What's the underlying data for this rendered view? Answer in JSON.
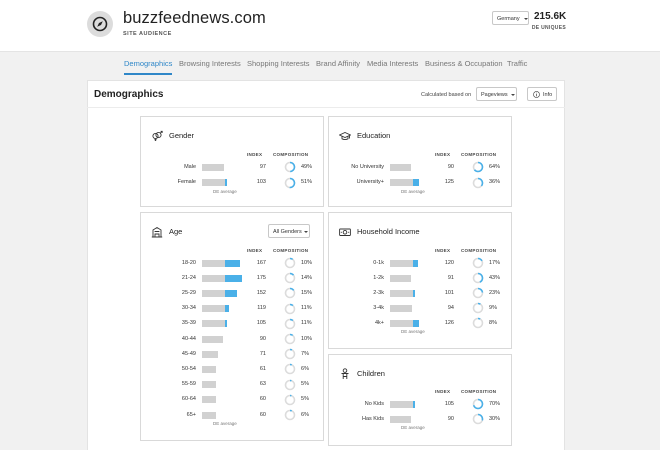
{
  "site": {
    "name": "buzzfeednews.com",
    "subtitle": "SITE AUDIENCE"
  },
  "country": "Germany",
  "uniques": {
    "value": "215.6K",
    "label": "DE UNIQUES"
  },
  "tabs": [
    "Demographics",
    "Browsing Interests",
    "Shopping Interests",
    "Brand Affinity",
    "Media Interests",
    "Business & Occupation",
    "Traffic"
  ],
  "main": {
    "title": "Demographics",
    "calc_label": "Calculated based on",
    "calc_value": "Pageviews",
    "info_label": "Info"
  },
  "headers": {
    "index": "INDEX",
    "composition": "COMPOSITION",
    "avg": "DE average"
  },
  "accent_color": "#4ab0e8",
  "bar_track_color": "#d1d1d1",
  "cards": {
    "gender": {
      "title": "Gender",
      "icon": "gender-icon",
      "rows": [
        {
          "label": "Male",
          "index": 97,
          "comp": 49
        },
        {
          "label": "Female",
          "index": 103,
          "comp": 51
        }
      ]
    },
    "education": {
      "title": "Education",
      "icon": "graduation-cap-icon",
      "rows": [
        {
          "label": "No University",
          "index": 90,
          "comp": 64
        },
        {
          "label": "University+",
          "index": 125,
          "comp": 36
        }
      ]
    },
    "age": {
      "title": "Age",
      "icon": "building-icon",
      "filter": "All Genders",
      "rows": [
        {
          "label": "18-20",
          "index": 167,
          "comp": 10
        },
        {
          "label": "21-24",
          "index": 175,
          "comp": 14
        },
        {
          "label": "25-29",
          "index": 152,
          "comp": 15
        },
        {
          "label": "30-34",
          "index": 119,
          "comp": 11
        },
        {
          "label": "35-39",
          "index": 105,
          "comp": 11
        },
        {
          "label": "40-44",
          "index": 90,
          "comp": 10
        },
        {
          "label": "45-49",
          "index": 71,
          "comp": 7
        },
        {
          "label": "50-54",
          "index": 61,
          "comp": 6
        },
        {
          "label": "55-59",
          "index": 63,
          "comp": 5
        },
        {
          "label": "60-64",
          "index": 60,
          "comp": 5
        },
        {
          "label": "65+",
          "index": 60,
          "comp": 6
        }
      ]
    },
    "income": {
      "title": "Household Income",
      "icon": "money-icon",
      "rows": [
        {
          "label": "0-1k",
          "index": 120,
          "comp": 17
        },
        {
          "label": "1-2k",
          "index": 91,
          "comp": 43
        },
        {
          "label": "2-3k",
          "index": 101,
          "comp": 23
        },
        {
          "label": "3-4k",
          "index": 94,
          "comp": 9
        },
        {
          "label": "4k+",
          "index": 126,
          "comp": 8
        }
      ]
    },
    "children": {
      "title": "Children",
      "icon": "child-icon",
      "rows": [
        {
          "label": "No Kids",
          "index": 105,
          "comp": 70
        },
        {
          "label": "Has Kids",
          "index": 90,
          "comp": 30
        }
      ]
    }
  }
}
